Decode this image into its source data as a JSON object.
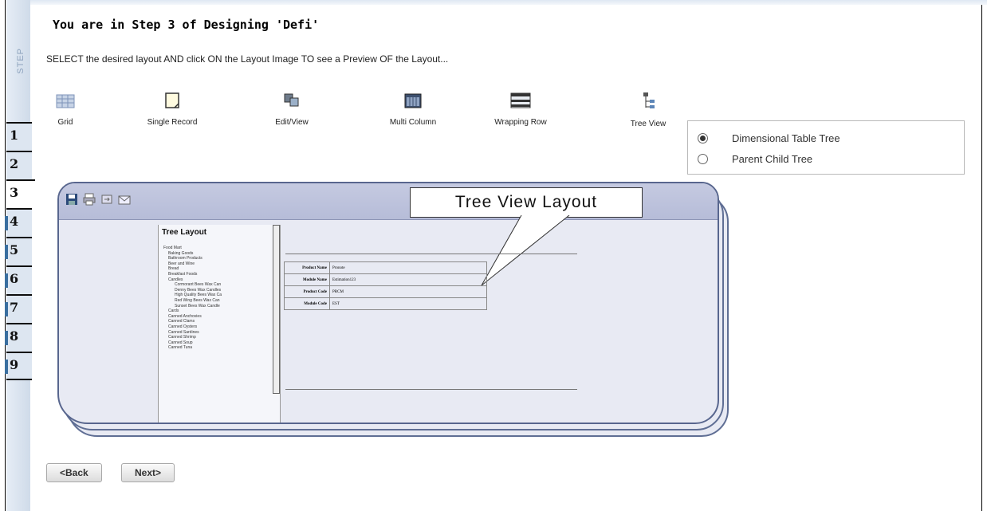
{
  "step_rail": {
    "label": "STEP",
    "tabs": [
      "1",
      "2",
      "3",
      "4",
      "5",
      "6",
      "7",
      "8",
      "9"
    ],
    "active_tab": "3"
  },
  "header": {
    "title": "You are in Step 3 of Designing 'Defi'",
    "instruction": "SELECT the desired layout AND click ON the Layout Image TO see a Preview OF the Layout..."
  },
  "layouts": [
    {
      "label": "Grid",
      "icon": "grid-icon"
    },
    {
      "label": "Single Record",
      "icon": "single-record-icon"
    },
    {
      "label": "Edit/View",
      "icon": "edit-view-icon"
    },
    {
      "label": "Multi Column",
      "icon": "multi-column-icon"
    },
    {
      "label": "Wrapping Row",
      "icon": "wrapping-row-icon"
    },
    {
      "label": "Tree View",
      "icon": "tree-view-icon"
    }
  ],
  "tree_options": {
    "items": [
      "Dimensional Table Tree",
      "Parent Child Tree"
    ],
    "selected": "Dimensional Table Tree"
  },
  "preview": {
    "callout": "Tree View Layout",
    "tree_title": "Tree Layout",
    "tree_items": [
      "Food Mart",
      "Baking Goods",
      "Bathroom Products",
      "Beer and Wine",
      "Bread",
      "Breakfast Foods",
      "Candles",
      "Cormorant Bees Wax Can",
      "Denny Bees Wax Candles",
      "High Quality Bees Wax Ca",
      "Red Wing Bees Wax Can",
      "Sunset Bees Wax Candle",
      "Cards",
      "Canned Anchovies",
      "Canned Clams",
      "Canned Oysters",
      "Canned Sardines",
      "Canned Shrimp",
      "Canned Soup",
      "Canned Tuna"
    ],
    "fields": [
      {
        "key": "Product Name",
        "value": "Pronote"
      },
      {
        "key": "Module Name",
        "value": "Estimation123"
      },
      {
        "key": "Product Code",
        "value": "PRCM"
      },
      {
        "key": "Module Code",
        "value": "EST"
      }
    ]
  },
  "buttons": {
    "back": "<Back",
    "next": "Next>"
  }
}
